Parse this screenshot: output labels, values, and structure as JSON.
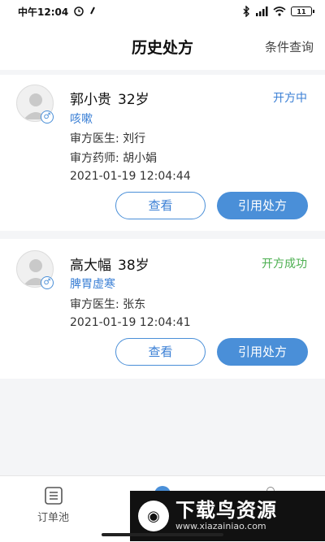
{
  "status_bar": {
    "time": "中午12:04",
    "battery": "11"
  },
  "header": {
    "title": "历史处方",
    "action_label": "条件查询"
  },
  "prescriptions": [
    {
      "name": "郭小贵",
      "age": "32岁",
      "diagnosis": "咳嗽",
      "status": "开方中",
      "status_color": "#3a7fd5",
      "doctor": "审方医生: 刘行",
      "pharmacist": "审方药师: 胡小娟",
      "datetime": "2021-01-19 12:04:44",
      "view_label": "查看",
      "reuse_label": "引用处方"
    },
    {
      "name": "高大幅",
      "age": "38岁",
      "diagnosis": "脾胃虚寒",
      "status": "开方成功",
      "status_color": "#4caf50",
      "doctor": "审方医生: 张东",
      "datetime": "2021-01-19 12:04:41",
      "view_label": "查看",
      "reuse_label": "引用处方"
    }
  ],
  "tabbar": {
    "orders_label": "订单池"
  },
  "watermark": {
    "title": "下载鸟资源",
    "url": "www.xiazainiao.com"
  },
  "colors": {
    "accent": "#4a8fd8",
    "success": "#4caf50"
  }
}
